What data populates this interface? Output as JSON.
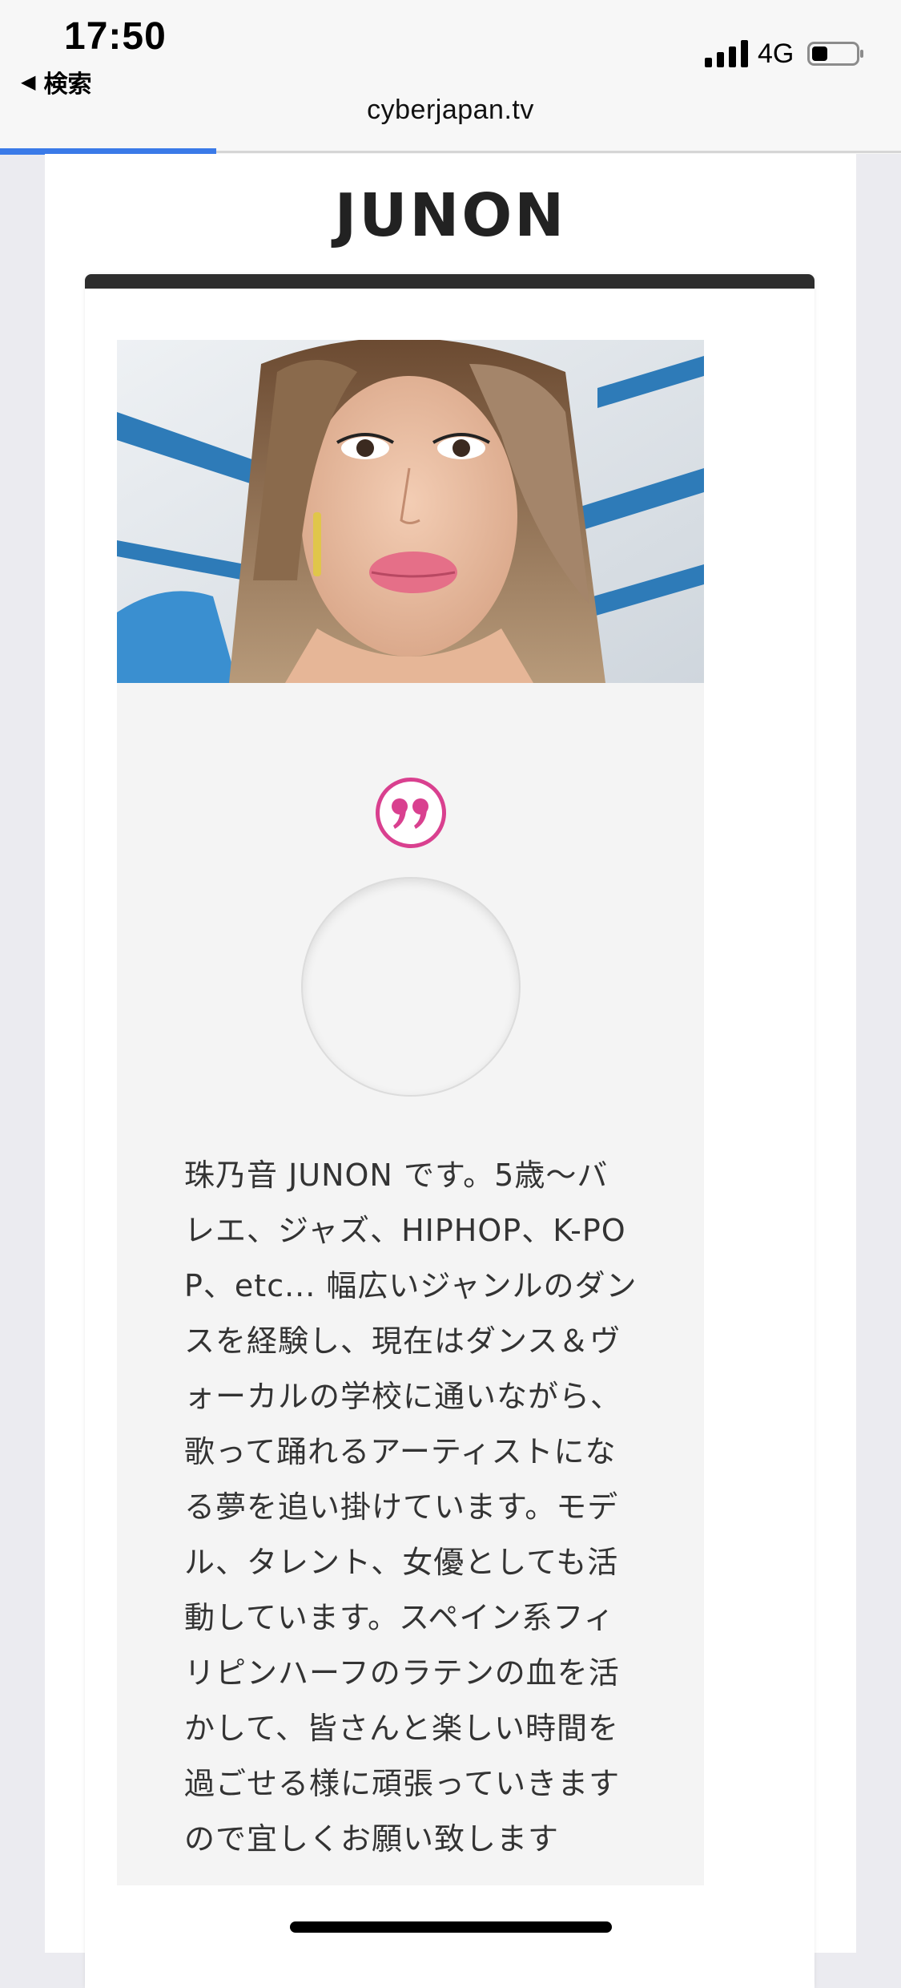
{
  "status_bar": {
    "time": "17:50",
    "back_label": "検索",
    "back_icon": "back-triangle-icon",
    "network": "4G",
    "signal_icon": "cellular-signal-icon",
    "battery_icon": "battery-icon",
    "battery_level": 0.35
  },
  "browser": {
    "url": "cyberjapan.tv",
    "load_progress": 0.24
  },
  "page": {
    "title": "JUNON",
    "quote_icon": "quote-mark-icon",
    "bio": "珠乃音 JUNON です。5歳〜バレエ、ジャズ、HIPHOP、K-POP、etc... 幅広いジャンルのダンスを経験し、現在はダンス＆ヴォーカルの学校に通いながら、歌って踊れるアーティストになる夢を追い掛けています。モデル、タレント、女優としても活動しています。スペイン系フィリピンハーフのラテンの血を活かして、皆さんと楽しい時間を過ごせる様に頑張っていきますので宜しくお願い致します"
  },
  "colors": {
    "accent_pink": "#d9408f",
    "progress_blue": "#3a7ae8",
    "card_top_bar": "#2d2d2d"
  }
}
